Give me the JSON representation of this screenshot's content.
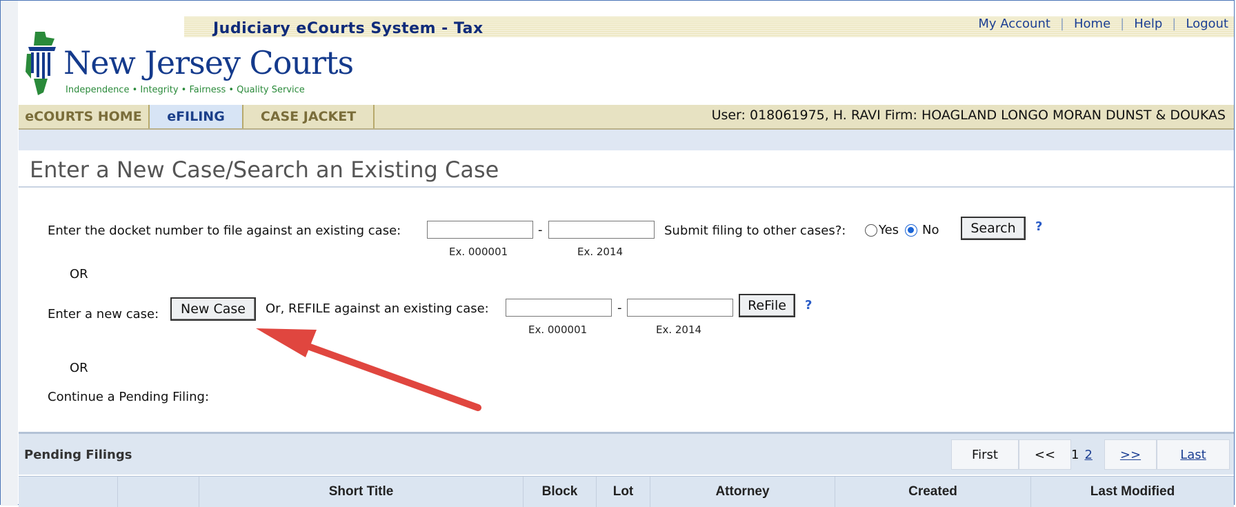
{
  "header": {
    "system_title": "Judiciary eCourts System - Tax",
    "logo_name": "New Jersey Courts",
    "logo_tagline": "Independence • Integrity • Fairness • Quality Service",
    "top_links": [
      "My Account",
      "Home",
      "Help",
      "Logout"
    ]
  },
  "nav": {
    "tabs": [
      {
        "label": "eCOURTS HOME",
        "active": false
      },
      {
        "label": "eFILING",
        "active": true
      },
      {
        "label": "CASE JACKET",
        "active": false
      }
    ],
    "user_line": "User: 018061975, H. RAVI  Firm: HOAGLAND LONGO MORAN DUNST & DOUKAS"
  },
  "main": {
    "page_title": "Enter a New Case/Search an Existing Case",
    "docket": {
      "label": "Enter the docket number to file against an existing case:",
      "dash": "-",
      "hint1": "Ex. 000001",
      "hint2": "Ex. 2014",
      "value1": "",
      "value2": "",
      "submit_other_label": "Submit filing to other cases?:",
      "yes_label": "Yes",
      "no_label": "No",
      "selected": "No",
      "search_button": "Search",
      "help": "?"
    },
    "or1": "OR",
    "new_case": {
      "label": "Enter a new case:",
      "button": "New Case",
      "refile_label": "Or, REFILE against an existing case:",
      "dash": "-",
      "hint1": "Ex. 000001",
      "hint2": "Ex. 2014",
      "value1": "",
      "value2": "",
      "refile_button": "ReFile",
      "help": "?"
    },
    "or2": "OR",
    "continue_label": "Continue a Pending Filing:"
  },
  "colors": {
    "accent_blue": "#1c3f93",
    "nav_tan": "#e7e2c2",
    "active_tab": "#d7e4f5",
    "arrow_red": "#e0463f"
  },
  "pending": {
    "title": "Pending Filings",
    "pager": {
      "first": "First",
      "prev": "<<",
      "pages": [
        "1",
        "2"
      ],
      "current": "1",
      "next": ">>",
      "last": "Last"
    },
    "columns": [
      "",
      "",
      "Short Title",
      "Block",
      "Lot",
      "Attorney",
      "Created",
      "Last Modified"
    ]
  }
}
